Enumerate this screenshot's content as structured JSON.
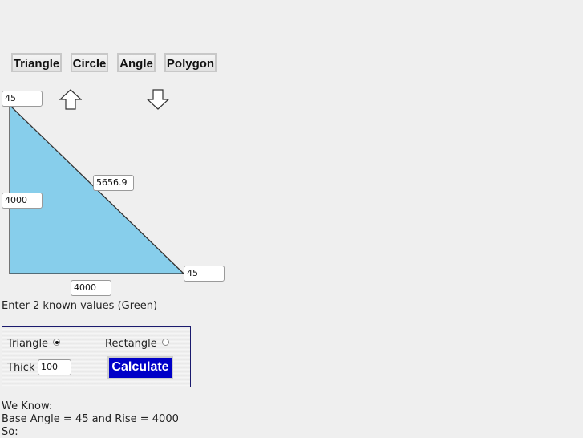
{
  "tabs": [
    {
      "label": "Triangle"
    },
    {
      "label": "Circle"
    },
    {
      "label": "Angle"
    },
    {
      "label": "Polygon"
    }
  ],
  "arrows": {
    "up": "up-arrow-icon",
    "down": "down-arrow-icon"
  },
  "triangle": {
    "top_angle": "45",
    "rise": "4000",
    "hypotenuse": "5656.9",
    "base": "4000",
    "base_angle": "45",
    "fill_color": "#87ceeb",
    "stroke_color": "#333333"
  },
  "instruction": "Enter 2 known values (Green)",
  "panel": {
    "triangle_label": "Triangle",
    "triangle_selected": true,
    "rectangle_label": "Rectangle",
    "rectangle_selected": false,
    "thick_label": "Thick",
    "thick_value": "100",
    "calculate_label": "Calculate"
  },
  "result": {
    "line1": "We Know:",
    "line2": "Base Angle = 45 and Rise = 4000",
    "line3": "So:"
  }
}
